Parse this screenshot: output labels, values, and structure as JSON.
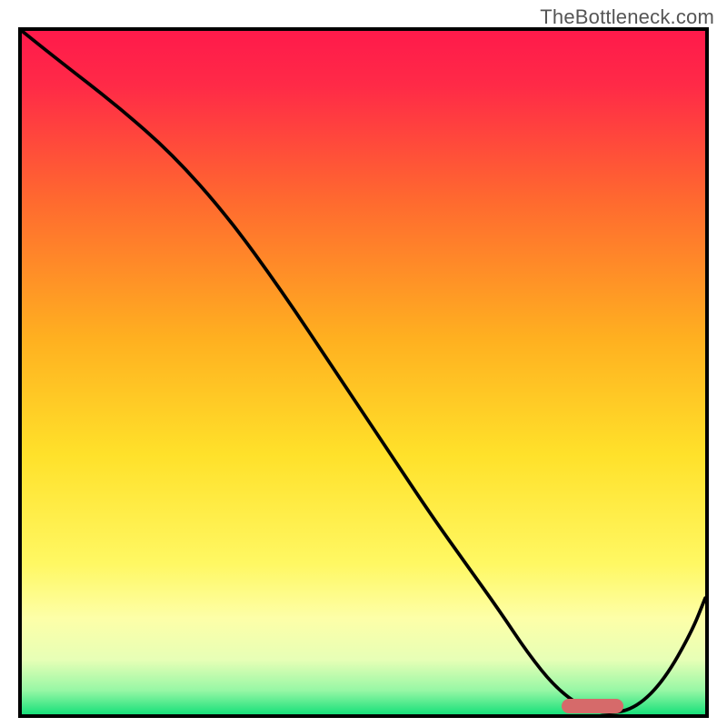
{
  "watermark": "TheBottleneck.com",
  "colors": {
    "frame": "#000000",
    "gradient_stops": [
      {
        "offset": 0.0,
        "color": "#ff1a4b"
      },
      {
        "offset": 0.08,
        "color": "#ff2a47"
      },
      {
        "offset": 0.25,
        "color": "#ff6a2f"
      },
      {
        "offset": 0.45,
        "color": "#ffb020"
      },
      {
        "offset": 0.62,
        "color": "#ffe12a"
      },
      {
        "offset": 0.78,
        "color": "#fff863"
      },
      {
        "offset": 0.86,
        "color": "#fdffa8"
      },
      {
        "offset": 0.92,
        "color": "#e7ffb6"
      },
      {
        "offset": 0.965,
        "color": "#97f7a5"
      },
      {
        "offset": 1.0,
        "color": "#18e07a"
      }
    ],
    "curve": "#000000",
    "blob": "#d66a6a"
  },
  "chart_data": {
    "type": "line",
    "title": "",
    "xlabel": "",
    "ylabel": "",
    "xlim": [
      0,
      100
    ],
    "ylim": [
      0,
      100
    ],
    "grid": false,
    "annotation": "TheBottleneck.com",
    "series": [
      {
        "name": "bottleneck-curve",
        "x": [
          0,
          5,
          14,
          22,
          30,
          38,
          46,
          54,
          60,
          65,
          70,
          74,
          78,
          82,
          86,
          90,
          94,
          98,
          100
        ],
        "y": [
          100,
          96,
          89,
          82,
          73,
          62,
          50,
          38,
          29,
          22,
          15,
          9,
          4,
          1,
          0,
          1,
          5,
          12,
          17
        ]
      }
    ],
    "minimum_marker": {
      "x_start": 79,
      "x_end": 88,
      "y": 0.6
    }
  }
}
